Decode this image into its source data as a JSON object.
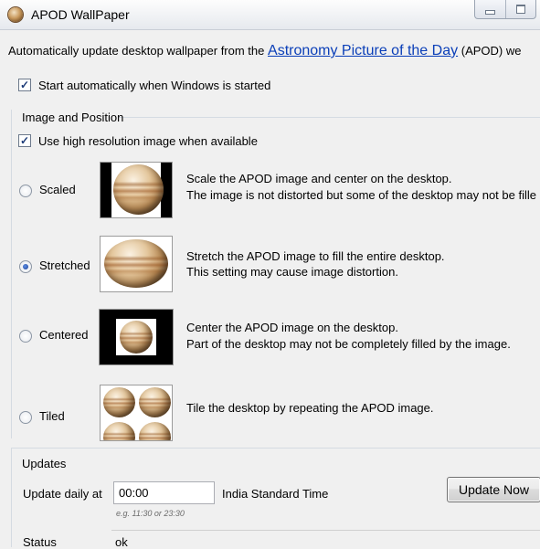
{
  "window": {
    "title": "APOD WallPaper"
  },
  "intro": {
    "prefix": "Automatically update desktop wallpaper from the",
    "link": "Astronomy Picture of the Day",
    "suffix": "(APOD) we"
  },
  "startup": {
    "label": "Start automatically when Windows is started",
    "checked": true
  },
  "image_position": {
    "heading": "Image and Position",
    "hires": {
      "label": "Use high resolution image when available",
      "checked": true
    },
    "options": [
      {
        "label": "Scaled",
        "selected": false,
        "line1": "Scale the APOD image and center on the desktop.",
        "line2": "The image is not distorted but some of the desktop may not be fille"
      },
      {
        "label": "Stretched",
        "selected": true,
        "line1": "Stretch the APOD image to fill the entire desktop.",
        "line2": "This setting may cause image distortion."
      },
      {
        "label": "Centered",
        "selected": false,
        "line1": "Center the APOD image on the desktop.",
        "line2": "Part of the desktop may not be completely filled by the image."
      },
      {
        "label": "Tiled",
        "selected": false,
        "line1": "Tile the desktop by repeating the APOD image.",
        "line2": ""
      }
    ]
  },
  "updates": {
    "heading": "Updates",
    "daily_label": "Update daily at",
    "time_value": "00:00",
    "time_hint": "e.g. 11:30 or 23:30",
    "timezone": "India Standard Time",
    "update_now": "Update Now",
    "status_label": "Status",
    "status_value": "ok"
  },
  "icons": {
    "app": "planet-icon",
    "minimize": "minimize-icon",
    "maximize": "maximize-icon"
  }
}
